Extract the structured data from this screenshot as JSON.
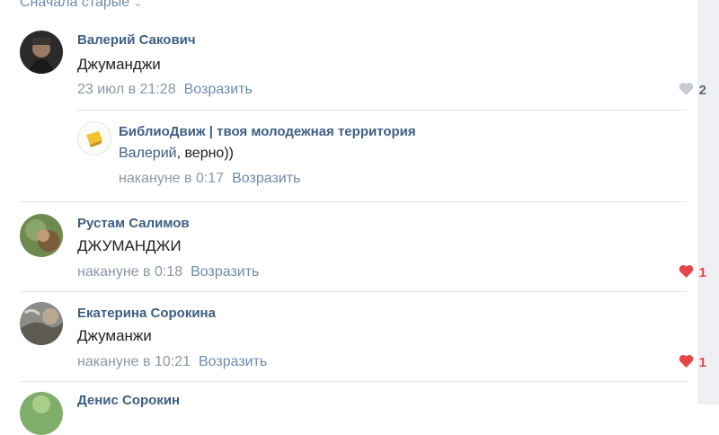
{
  "sort": {
    "label": "Сначала старые"
  },
  "comments": [
    {
      "author": "Валерий Сакович",
      "text": "Джуманджи",
      "date": "23 июл в 21:28",
      "reply": "Возразить",
      "likes": "2",
      "liked": false
    },
    {
      "author": "БиблиоДвиж | твоя молодежная территория",
      "mention": "Валерий",
      "text_rest": ", верно))",
      "date": "накануне в 0:17",
      "reply": "Возразить"
    },
    {
      "author": "Рустам Салимов",
      "text": "ДЖУМАНДЖИ",
      "date": "накануне в 0:18",
      "reply": "Возразить",
      "likes": "1",
      "liked": true
    },
    {
      "author": "Екатерина Сорокина",
      "text": "Джуманжи",
      "date": "накануне в 10:21",
      "reply": "Возразить",
      "likes": "1",
      "liked": true
    },
    {
      "author": "Денис Сорокин"
    }
  ],
  "colors": {
    "author": "#3d5f84",
    "link": "#6e8bad",
    "meta": "#8a97a6",
    "heart_liked": "#e64646",
    "heart_default": "#c6ccd3"
  }
}
